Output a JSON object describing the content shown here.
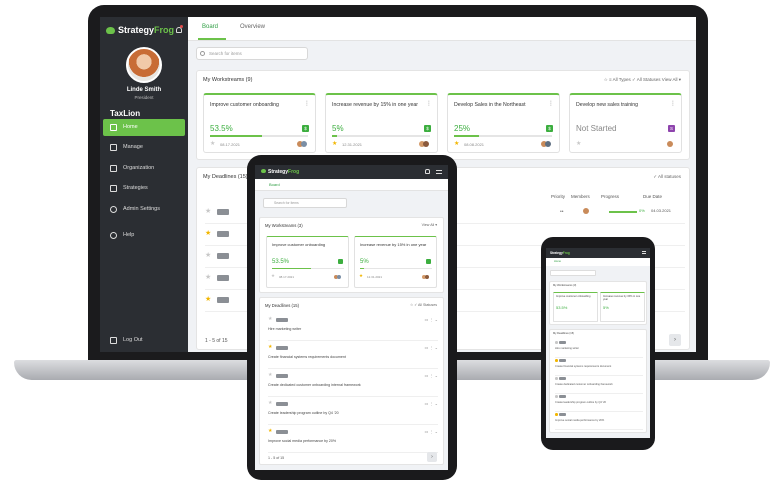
{
  "brand": {
    "name_a": "Strategy",
    "name_b": "Frog",
    "accent": "#6cc24a",
    "sidebar_bg": "#2b2e33"
  },
  "laptop": {
    "user": {
      "name": "Linde Smith",
      "role": "President"
    },
    "org": "TaxLion",
    "nav": [
      {
        "label": "Home",
        "icon": "home-icon"
      },
      {
        "label": "Manage",
        "icon": "checklist-icon"
      },
      {
        "label": "Organization",
        "icon": "org-chart-icon"
      },
      {
        "label": "Strategies",
        "icon": "strategy-icon"
      },
      {
        "label": "Admin Settings",
        "icon": "gear-icon"
      },
      {
        "label": "Help",
        "icon": "help-icon"
      },
      {
        "label": "Log Out",
        "icon": "logout-icon"
      }
    ],
    "tabs": [
      {
        "label": "Board"
      },
      {
        "label": "Overview"
      }
    ],
    "search_placeholder": "Search for items",
    "workstreams": {
      "title": "My Workstreams (9)",
      "tools": "☆   ≡ All Types          ✓ All Statuses          View All ▾",
      "cards": [
        {
          "title": "Improve customer onboarding",
          "percent": "53.5%",
          "progress": 0.535,
          "badge": "$",
          "starred": false,
          "date": "08.17.2021"
        },
        {
          "title": "Increase revenue by 15% in one year",
          "percent": "5%",
          "progress": 0.05,
          "badge": "$",
          "starred": true,
          "date": "12.31.2021"
        },
        {
          "title": "Develop Sales in the Northeast",
          "percent": "25%",
          "progress": 0.25,
          "badge": "$",
          "starred": true,
          "date": "08.08.2021"
        },
        {
          "title": "Develop new sales training",
          "percent": "Not Started",
          "progress": 0,
          "badge": "S",
          "starred": false,
          "date": ""
        }
      ]
    },
    "deadlines": {
      "title": "My Deadlines (15)",
      "tools": "✓ All statuses",
      "columns": [
        "Priority",
        "Members",
        "Progress",
        "Due Date"
      ],
      "rows": [
        {
          "starred": false,
          "progress_label": "0%",
          "due": "04.03.2021"
        },
        {
          "starred": true,
          "progress_label": "",
          "due": ""
        },
        {
          "starred": false,
          "progress_label": "",
          "due": ""
        },
        {
          "starred": false,
          "progress_label": "",
          "due": ""
        },
        {
          "starred": true,
          "progress_label": "",
          "due": ""
        }
      ],
      "pager": "1 - 5 of 15"
    }
  },
  "tablet": {
    "tab": "Board",
    "search_placeholder": "Search for items",
    "workstreams": {
      "title": "My Workstreams (3)",
      "view": "View All ▾",
      "cards": [
        {
          "title": "Improve customer onboarding",
          "percent": "53.5%",
          "progress": 0.535,
          "date": "08.17.2021",
          "starred": false
        },
        {
          "title": "Increase revenue by 15% in one year",
          "percent": "5%",
          "progress": 0.05,
          "date": "12.31.2021",
          "starred": true
        }
      ]
    },
    "deadlines": {
      "title": "My Deadlines (15)",
      "tools": "☆   ✓ All Statuses",
      "items": [
        {
          "starred": false,
          "text": "Hire marketing writer"
        },
        {
          "starred": true,
          "text": "Create financial systems requirements document"
        },
        {
          "starred": false,
          "text": "Create dedicated customer onboarding internal framework"
        },
        {
          "starred": false,
          "text": "Create leadership program outline by Q4 '20"
        },
        {
          "starred": true,
          "text": "Improve social media performance by 20%"
        }
      ],
      "pager": "1 - 5 of 15"
    }
  },
  "phone": {
    "tab": "Home",
    "workstreams_title": "My Workstreams (3)",
    "cards": [
      {
        "title": "Improve customer onboarding",
        "percent": "53.5%"
      },
      {
        "title": "Increase revenue by 15% in one year",
        "percent": "5%"
      }
    ],
    "deadlines_title": "My Deadlines (15)",
    "items": [
      {
        "starred": false,
        "text": "Hire marketing writer"
      },
      {
        "starred": true,
        "text": "Create financial systems requirements document"
      },
      {
        "starred": false,
        "text": "Create dedicated customer onboarding framework"
      },
      {
        "starred": false,
        "text": "Create leadership program outline by Q4 '20"
      },
      {
        "starred": true,
        "text": "Improve social media performance by 20%"
      }
    ]
  }
}
